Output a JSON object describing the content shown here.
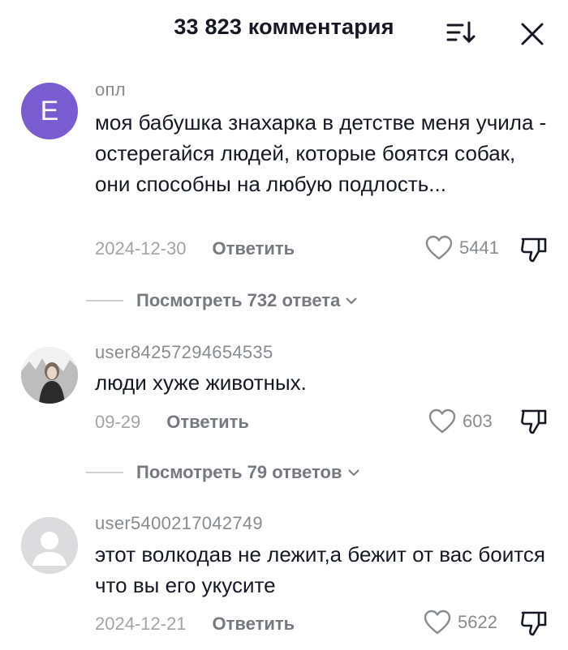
{
  "header": {
    "title": "33 823 комментария",
    "sort_icon": "sort-icon",
    "close_icon": "close-icon"
  },
  "comments": [
    {
      "username": "опл",
      "avatar_letter": "E",
      "avatar_color": "#7a5cd1",
      "text": "моя бабушка знахарка в детстве меня учила - остерегайся людей, которые боятся собак, они способны на любую подлость...",
      "date": "2024-12-30",
      "reply_label": "Ответить",
      "likes": "5441",
      "view_replies": "Посмотреть 732 ответа"
    },
    {
      "username": "user84257294654535",
      "text": "люди хуже животных.",
      "date": "09-29",
      "reply_label": "Ответить",
      "likes": "603",
      "view_replies": "Посмотреть 79 ответов"
    },
    {
      "username": "user5400217042749",
      "text": "этот волкодав не лежит,а бежит от вас боится что вы его укусите",
      "date": "2024-12-21",
      "reply_label": "Ответить",
      "likes": "5622"
    }
  ]
}
